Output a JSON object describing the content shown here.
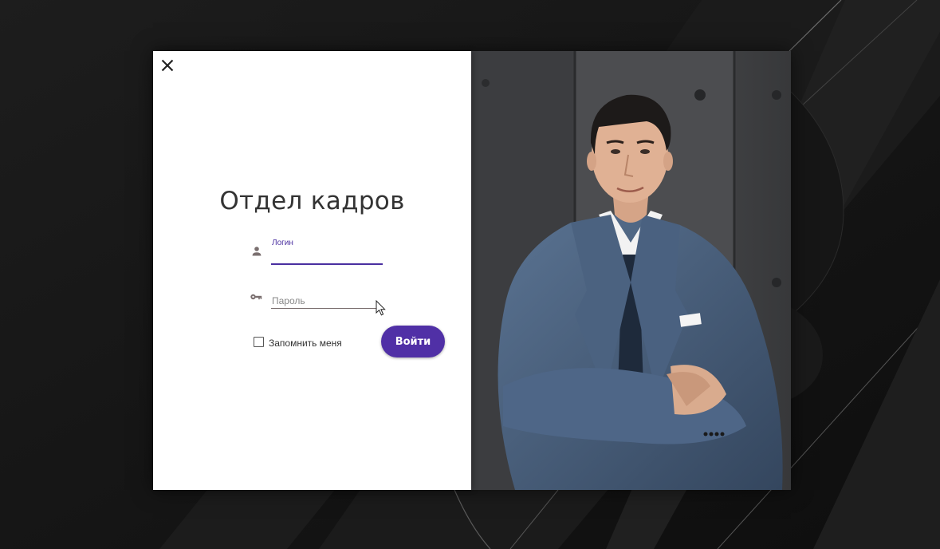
{
  "window": {
    "title": "Отдел кадров",
    "close_icon": "close-icon"
  },
  "form": {
    "login_label": "Логин",
    "login_value": "",
    "login_icon": "person-icon",
    "password_placeholder": "Пароль",
    "password_value": "",
    "password_icon": "key-icon",
    "remember_me_label": "Запомнить меня",
    "remember_me_checked": false,
    "submit_label": "Войти"
  },
  "photo": {
    "subject": "businessman-photo"
  },
  "colors": {
    "accent": "#5030a6",
    "panel_background": "#ffffff",
    "desktop_background": "#151515",
    "text_dark": "#333333"
  }
}
